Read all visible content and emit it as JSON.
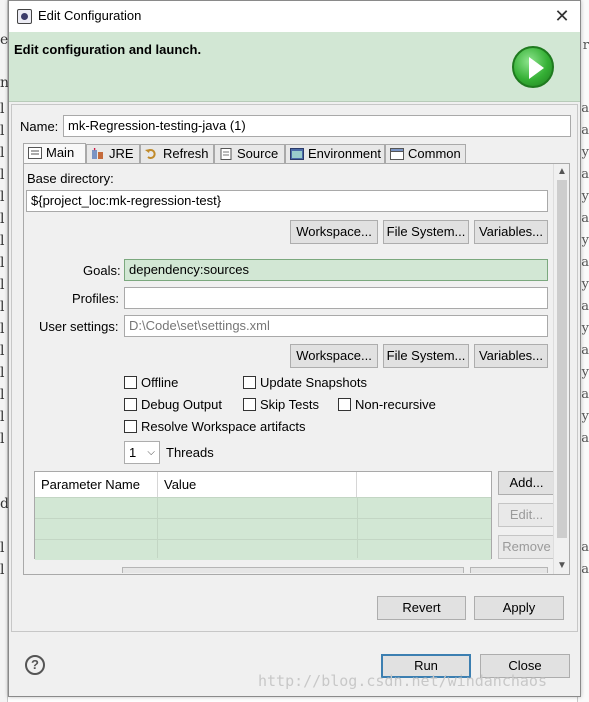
{
  "window": {
    "title": "Edit Configuration",
    "close_symbol": "✕"
  },
  "banner": {
    "heading": "Edit configuration and launch."
  },
  "name": {
    "label": "Name:",
    "value": "mk-Regression-testing-java (1)"
  },
  "tabs": [
    {
      "label": "Main",
      "icon": "main-tab-icon"
    },
    {
      "label": "JRE",
      "icon": "jre-icon"
    },
    {
      "label": "Refresh",
      "icon": "refresh-icon"
    },
    {
      "label": "Source",
      "icon": "source-icon"
    },
    {
      "label": "Environment",
      "icon": "environment-icon"
    },
    {
      "label": "Common",
      "icon": "common-icon"
    }
  ],
  "main": {
    "base_dir_label": "Base directory:",
    "base_dir_value": "${project_loc:mk-regression-test}",
    "workspace_btn": "Workspace...",
    "filesystem_btn": "File System...",
    "variables_btn": "Variables...",
    "goals_label": "Goals:",
    "goals_value": "dependency:sources",
    "profiles_label": "Profiles:",
    "profiles_value": "",
    "user_settings_label": "User settings:",
    "user_settings_value": "D:\\Code\\set\\settings.xml",
    "offline": "Offline",
    "update_snapshots": "Update Snapshots",
    "debug_output": "Debug Output",
    "skip_tests": "Skip Tests",
    "non_recursive": "Non-recursive",
    "resolve_workspace": "Resolve Workspace artifacts",
    "threads_value": "1",
    "threads_label": "Threads",
    "param_headers": [
      "Parameter Name",
      "Value"
    ],
    "add_btn": "Add...",
    "edit_btn": "Edit...",
    "remove_btn": "Remove"
  },
  "footer": {
    "revert": "Revert",
    "apply": "Apply",
    "run": "Run",
    "close": "Close",
    "help_symbol": "?"
  },
  "watermark": "http://blog.csdn.net/windanchaos",
  "colors": {
    "banner_bg": "#d2e7d4",
    "goal_bg": "#d2e7d4",
    "default_border": "#3c7fb1"
  }
}
